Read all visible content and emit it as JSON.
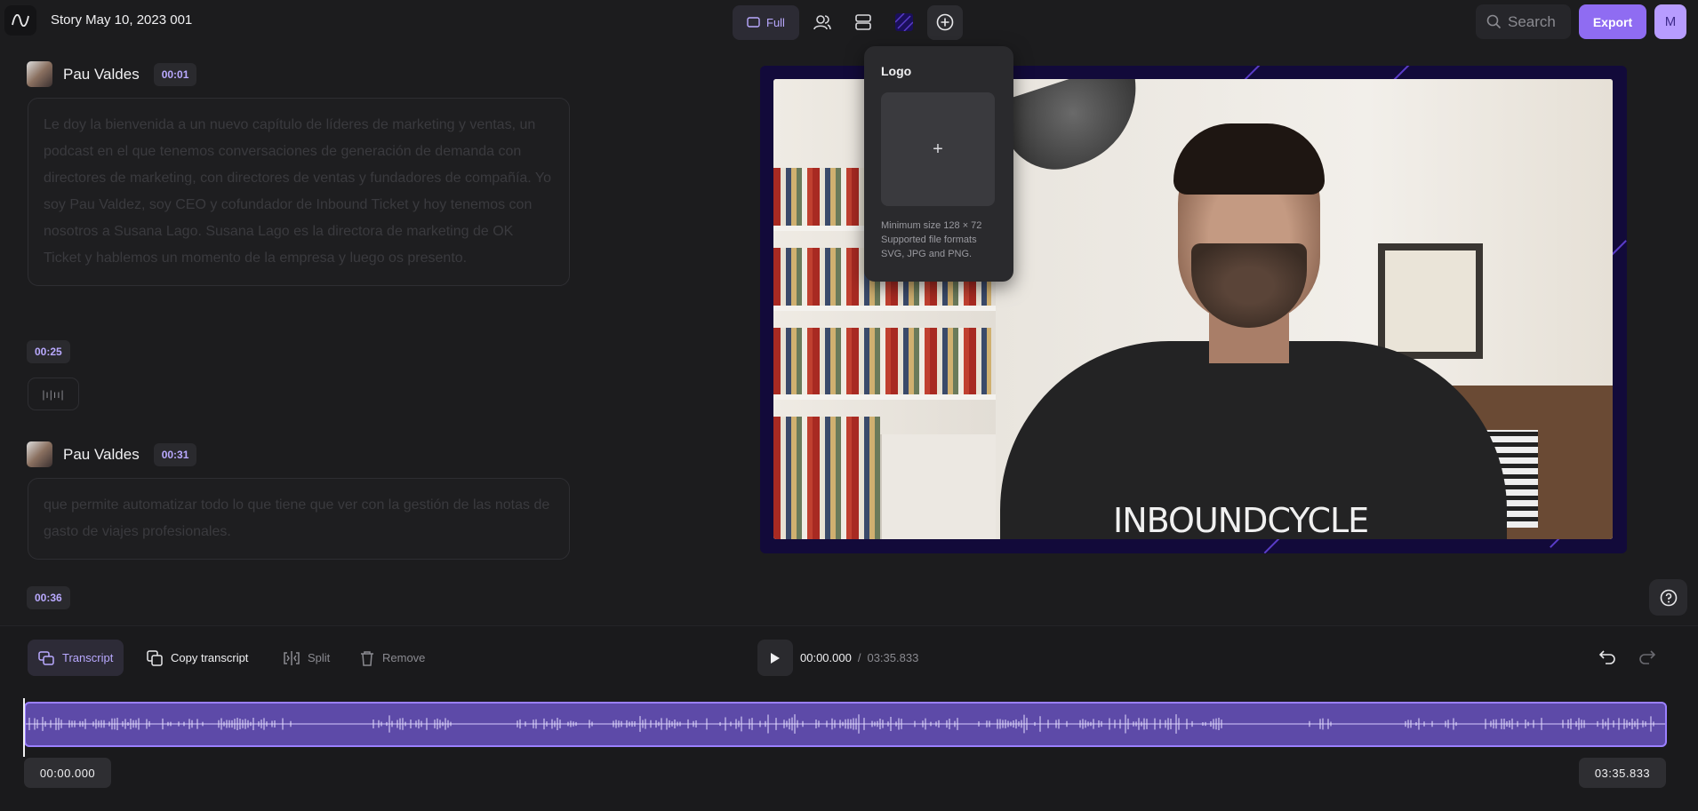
{
  "header": {
    "title": "Story May 10, 2023 001",
    "layout_label": "Full",
    "search_placeholder": "Search",
    "export_label": "Export",
    "user_initial": "M",
    "icons": [
      "app-logo-icon",
      "layout-icon",
      "speakers-icon",
      "layers-icon",
      "background-swatch-icon",
      "add-icon",
      "search-icon"
    ]
  },
  "transcript": {
    "segments": [
      {
        "speaker": "Pau Valdes",
        "time": "00:01",
        "text": "Le doy la bienvenida a un nuevo capítulo de líderes de marketing y ventas, un podcast en el que tenemos conversaciones de generación de demanda con directores de marketing, con directores de ventas y fundadores de compañía. Yo soy Pau Valdez, soy CEO y cofundador de Inbound Ticket y hoy tenemos con nosotros a Susana Lago. Susana Lago es la directora de marketing de OK Ticket y hablemos un momento de la empresa y luego os presento."
      },
      {
        "speaker": "Pau Valdes",
        "time": "00:31",
        "text": "que permite automatizar todo lo que tiene que ver con la gestión de las notas de gasto de viajes profesionales."
      }
    ],
    "pause_time": "00:25",
    "pause_glyph": "|ı|ıı|",
    "next_time": "00:36"
  },
  "video": {
    "brand_text": "INBOUNDCYCLE"
  },
  "logo_popover": {
    "title": "Logo",
    "upload_glyph": "+",
    "hint_line1": "Minimum size 128 × 72",
    "hint_line2": "Supported file formats",
    "hint_line3": "SVG, JPG and PNG."
  },
  "bottom": {
    "transcript_label": "Transcript",
    "copy_label": "Copy transcript",
    "split_label": "Split",
    "remove_label": "Remove",
    "current_time": "00:00.000",
    "separator": "/",
    "duration": "03:35.833",
    "start_tc": "00:00.000",
    "end_tc": "03:35.833"
  },
  "colors": {
    "accent": "#8f6cf2",
    "accent_light": "#b9a9ff",
    "waveform_fill": "#5d4aa8",
    "video_frame": "#120a3a"
  }
}
